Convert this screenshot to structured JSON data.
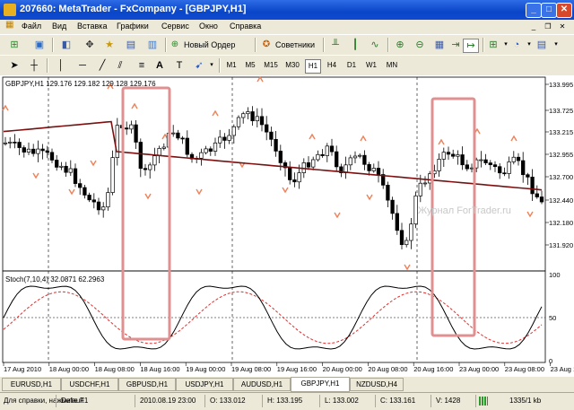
{
  "title": "207660: MetaTrader - FxCompany - [GBPJPY,H1]",
  "window_buttons": [
    "_",
    "□",
    "✕"
  ],
  "menu": [
    "Файл",
    "Вид",
    "Вставка",
    "Графики",
    "Сервис",
    "Окно",
    "Справка"
  ],
  "mdi_buttons": [
    "_",
    "❐",
    "✕"
  ],
  "toolbar": {
    "new_order_label": "Новый Ордер",
    "advisors_label": "Советники"
  },
  "timeframes": [
    "M1",
    "M5",
    "M15",
    "M30",
    "H1",
    "H4",
    "D1",
    "W1",
    "MN"
  ],
  "active_timeframe": "H1",
  "chart": {
    "info": "GBPJPY,H1  129.176 129.182 129.128 129.176",
    "price_labels": [
      "133.995",
      "133.725",
      "133.215",
      "132.955",
      "132.700",
      "132.440",
      "132.180",
      "131.920"
    ],
    "stoch_label": "Stoch(7,10,4) 32.0871 62.2963",
    "stoch_levels": [
      "100",
      "50",
      "0"
    ],
    "time_labels": [
      "17 Aug 2010",
      "18 Aug 00:00",
      "18 Aug 08:00",
      "18 Aug 16:00",
      "19 Aug 00:00",
      "19 Aug 08:00",
      "19 Aug 16:00",
      "20 Aug 00:00",
      "20 Aug 08:00",
      "20 Aug 16:00",
      "23 Aug 00:00",
      "23 Aug 08:00",
      "23 Aug 16:00"
    ],
    "watermark": "Журнал ForTrader.ru",
    "colors": {
      "ma": "#7a1010",
      "fractal": "#f08058",
      "stoch_main": "#000000",
      "stoch_signal": "#e03030",
      "highlight": "#e09090"
    }
  },
  "tabs": [
    "EURUSD,H1",
    "USDCHF,H1",
    "GBPUSD,H1",
    "USDJPY,H1",
    "AUDUSD,H1",
    "GBPJPY,H1",
    "NZDUSD,H4"
  ],
  "active_tab": "GBPJPY,H1",
  "status": {
    "help": "Для справки, нажмите F1",
    "profile": "Default",
    "datetime": "2010.08.19 23:00",
    "open": "O: 133.012",
    "high": "H: 133.195",
    "low": "L: 133.002",
    "close": "C: 133.161",
    "volume": "V: 1428",
    "traffic": "1335/1 kb"
  }
}
